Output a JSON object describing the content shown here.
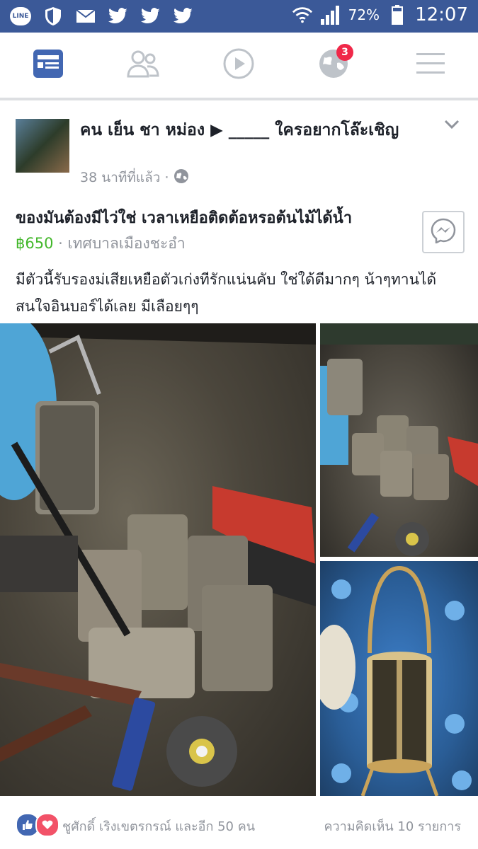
{
  "status_bar": {
    "battery": "72%",
    "time": "12:07",
    "left_icons": [
      "line-icon",
      "shield-icon",
      "mail-icon",
      "twitter-icon",
      "twitter-icon",
      "twitter-icon"
    ]
  },
  "navbar": {
    "items": [
      {
        "name": "news-feed",
        "icon": "news-feed-icon",
        "active": true
      },
      {
        "name": "friends",
        "icon": "friends-icon"
      },
      {
        "name": "video",
        "icon": "video-icon"
      },
      {
        "name": "notifications",
        "icon": "globe-icon",
        "badge": "3"
      },
      {
        "name": "menu",
        "icon": "menu-icon"
      }
    ],
    "accent": "#4267b2"
  },
  "post": {
    "author": "คน เย็น ชา หม่อง ▶ _____ ใครอยากโล๊ะเชิญ",
    "time": "38 นาทีที่แล้ว",
    "privacy_icon": "globe-icon",
    "listing_title": "ของมันต้องมีไว่ใช่ เวลาเหยือติดต้อหรอต้นไม้ได้น้ำ",
    "price": "฿650",
    "location": "เทศบาลเมืองชะอำ",
    "body": "มีตัวนี้รับรองม่เสียเหยือตัวเก่งทีรักแน่นคับ ใช่ใด้ดีมากๆ น้าๆทานได้สนใจอินบอร์ได้เลย มีเลือยๆๆ",
    "reactions_text": "ชูศักดิ์ เริงเขตรกรณ์ และอีก 50 คน",
    "comments_text": "ความคิดเห็น 10 รายการ",
    "price_color": "#42b72a"
  }
}
